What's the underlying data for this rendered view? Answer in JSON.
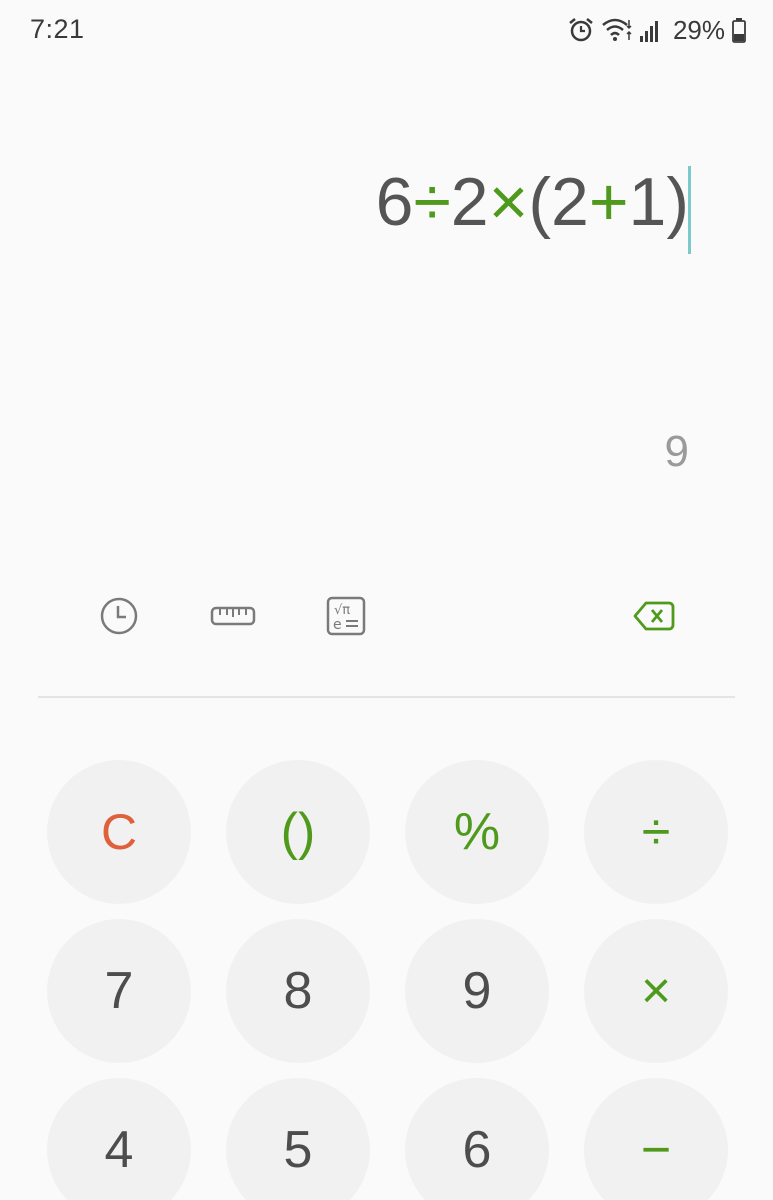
{
  "status_bar": {
    "time": "7:21",
    "battery": "29%",
    "icons": [
      "alarm-icon",
      "wifi-icon",
      "signal-icon",
      "battery-icon"
    ]
  },
  "display": {
    "expression_parts": [
      {
        "text": "6",
        "kind": "digit"
      },
      {
        "text": "÷",
        "kind": "op"
      },
      {
        "text": "2",
        "kind": "digit"
      },
      {
        "text": "×",
        "kind": "op"
      },
      {
        "text": "(2",
        "kind": "digit"
      },
      {
        "text": "+",
        "kind": "op"
      },
      {
        "text": "1)",
        "kind": "digit"
      }
    ],
    "result": "9"
  },
  "toolbar": {
    "icons": [
      "history-icon",
      "unit-converter-icon",
      "scientific-icon",
      "backspace-icon"
    ]
  },
  "keypad": {
    "rows": [
      [
        {
          "label": "C",
          "name": "clear-button",
          "style": "clear"
        },
        {
          "label": "()",
          "name": "parentheses-button",
          "style": "op"
        },
        {
          "label": "%",
          "name": "percent-button",
          "style": "op"
        },
        {
          "label": "÷",
          "name": "divide-button",
          "style": "op"
        }
      ],
      [
        {
          "label": "7",
          "name": "digit-7-button",
          "style": "digit"
        },
        {
          "label": "8",
          "name": "digit-8-button",
          "style": "digit"
        },
        {
          "label": "9",
          "name": "digit-9-button",
          "style": "digit"
        },
        {
          "label": "×",
          "name": "multiply-button",
          "style": "op"
        }
      ],
      [
        {
          "label": "4",
          "name": "digit-4-button",
          "style": "digit"
        },
        {
          "label": "5",
          "name": "digit-5-button",
          "style": "digit"
        },
        {
          "label": "6",
          "name": "digit-6-button",
          "style": "digit"
        },
        {
          "label": "−",
          "name": "subtract-button",
          "style": "op"
        }
      ]
    ]
  },
  "colors": {
    "accent": "#4f9a1d",
    "clear": "#e0603a",
    "key_bg": "#f1f1f1",
    "cursor": "#7cc9c9"
  }
}
